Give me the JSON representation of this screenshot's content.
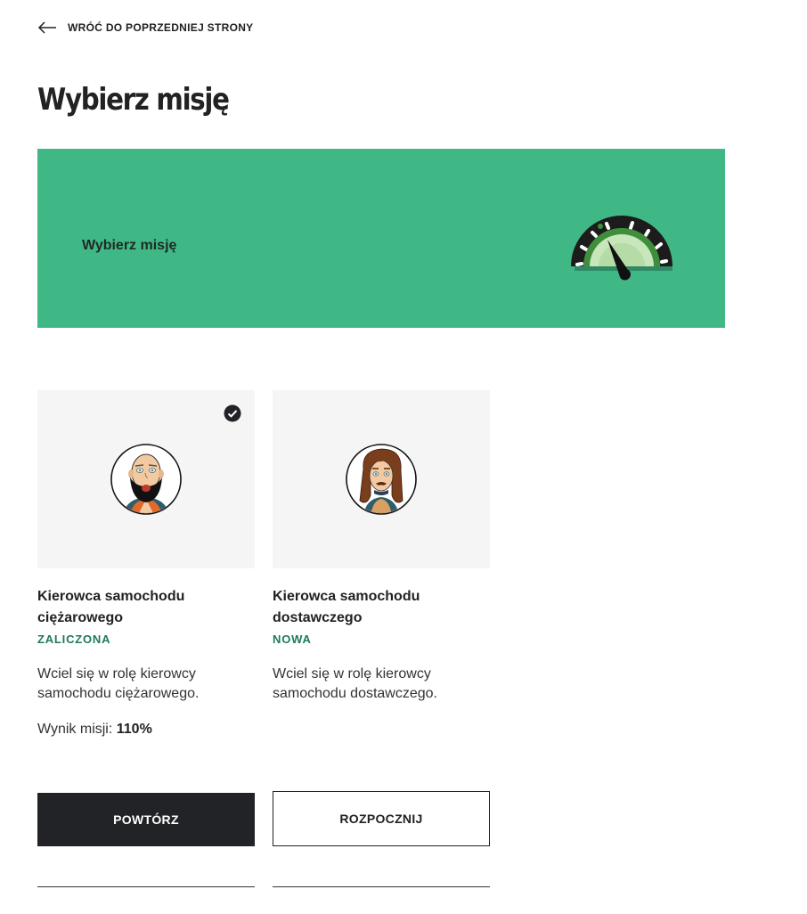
{
  "back": {
    "label": "WRÓĆ DO POPRZEDNIEJ STRONY",
    "icon": "arrow-left-icon"
  },
  "page": {
    "title": "Wybierz misję"
  },
  "banner": {
    "text": "Wybierz misję",
    "background": "#3fb886",
    "icon": "speedometer-icon"
  },
  "missions": [
    {
      "title": "Kierowca samochodu ciężarowego",
      "status": "ZALICZONA",
      "completed": true,
      "description": "Wciel się w rolę kierowcy samochodu ciężarowego.",
      "score_label": "Wynik misji:",
      "score_value": "110%",
      "button": "POWTÓRZ",
      "avatar": "bald-bearded-driver-avatar"
    },
    {
      "title": "Kierowca samochodu dostawczego",
      "status": "NOWA",
      "completed": false,
      "description": "Wciel się w rolę kierowcy samochodu dostawczego.",
      "button": "ROZPOCZNIJ",
      "avatar": "long-haired-driver-avatar"
    }
  ],
  "colors": {
    "accent": "#3fb886",
    "status": "#1f7a5a",
    "dark_button": "#222327"
  }
}
